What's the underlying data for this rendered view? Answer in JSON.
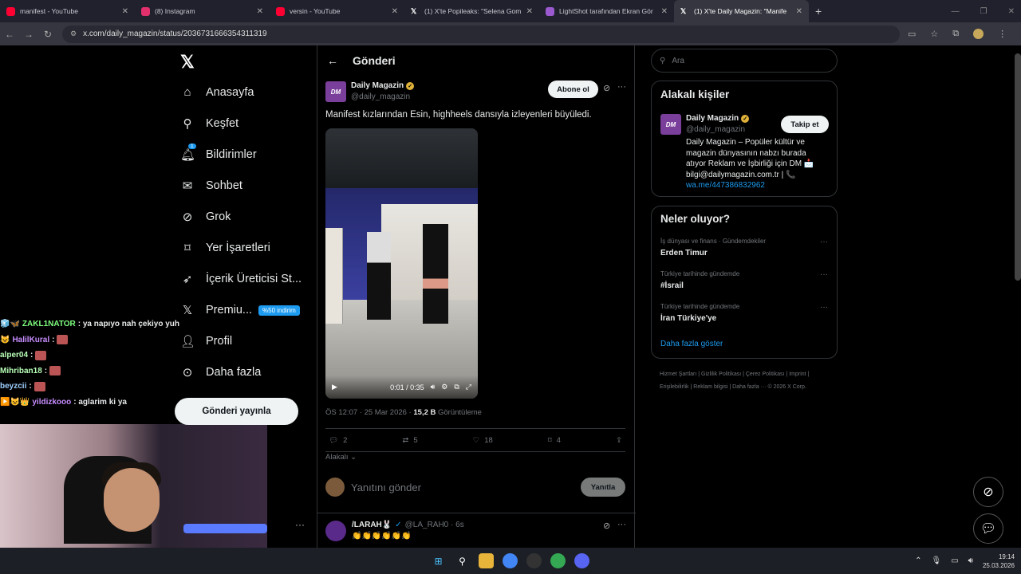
{
  "browser": {
    "tabs": [
      {
        "title": "manifest - YouTube",
        "icon": "youtube-icon",
        "color": "#ff0033"
      },
      {
        "title": "(8) Instagram",
        "icon": "instagram-icon",
        "color": "#e1306c"
      },
      {
        "title": "versin - YouTube",
        "icon": "youtube-icon",
        "color": "#ff0033"
      },
      {
        "title": "(1) X'te Popileaks: \"Selena Gom",
        "icon": "x-icon",
        "color": "#ffffff"
      },
      {
        "title": "LightShot tarafından Ekran Gör",
        "icon": "lightshot-icon",
        "color": "#9b59d0"
      },
      {
        "title": "(1) X'te Daily Magazin: \"Manife",
        "icon": "x-icon",
        "color": "#ffffff"
      }
    ],
    "url": "x.com/daily_magazin/status/2036731666354311319"
  },
  "sidebar": {
    "items": [
      {
        "label": "Anasayfa",
        "icon": "home-icon"
      },
      {
        "label": "Keşfet",
        "icon": "search-icon"
      },
      {
        "label": "Bildirimler",
        "icon": "bell-icon"
      },
      {
        "label": "Sohbet",
        "icon": "mail-icon"
      },
      {
        "label": "Grok",
        "icon": "grok-icon"
      },
      {
        "label": "Yer İşaretleri",
        "icon": "bookmark-icon"
      },
      {
        "label": "İçerik Üreticisi St...",
        "icon": "rocket-icon"
      },
      {
        "label": "Premiu...",
        "icon": "x-icon"
      },
      {
        "label": "Profil",
        "icon": "person-icon"
      },
      {
        "label": "Daha fazla",
        "icon": "more-icon"
      }
    ],
    "notification_count": "1",
    "premium_badge": "%50 indirim",
    "post_button": "Gönderi yayınla"
  },
  "main": {
    "header_title": "Gönderi",
    "author_name": "Daily Magazin",
    "author_handle": "@daily_magazin",
    "avatar_text": "DM",
    "follow_button": "Abone ol",
    "tweet_text": "Manifest kızlarından Esin, highheels dansıyla izleyenleri büyüledi.",
    "video_time": "0:01 / 0:35",
    "meta_time": "ÖS 12:07 · 25 Mar 2026 · ",
    "meta_views": "15,2 B",
    "meta_views_label": " Görüntüleme",
    "actions": {
      "replies": "2",
      "reposts": "5",
      "likes": "18",
      "bookmarks": "4"
    },
    "related": "Alakalı",
    "reply_placeholder": "Yanıtını gönder",
    "reply_button": "Yanıtla",
    "reply": {
      "name": "/LARAH🐰",
      "handle": "@LA_RAH0 · 6s",
      "text": "👏👏👏👏👏👏"
    }
  },
  "right": {
    "search_placeholder": "Ara",
    "related_title": "Alakalı kişiler",
    "person_name": "Daily Magazin",
    "person_handle": "@daily_magazin",
    "person_follow": "Takip et",
    "bio": "Daily Magazin – Popüler kültür ve magazin dünyasının nabzı burada atıyor Reklam ve İşbirliği için DM 📩 bilgi@dailymagazin.com.tr | 📞",
    "bio_link": "wa.me/447386832962",
    "trends_title": "Neler oluyor?",
    "trends": [
      {
        "category": "İş dünyası ve finans · Gündemdekiler",
        "name": "Erden Timur"
      },
      {
        "category": "Türkiye tarihinde gündemde",
        "name": "#İsrail"
      },
      {
        "category": "Türkiye tarihinde gündemde",
        "name": "İran Türkiye'ye"
      }
    ],
    "show_more": "Daha fazla göster",
    "footer": "Hizmet Şartları  |  Gizlilik Politikası  |  Çerez Politikası  |  Imprint  |  Erişilebilirlik  |  Reklam bilgisi  |  Daha fazla ···  © 2026 X Corp."
  },
  "chat": [
    {
      "user": "ZAKL1NATOR",
      "color": "#7fff7f",
      "msg": ": ya napıyo nah çekiyo yuh",
      "badges": "🧊🦋"
    },
    {
      "user": "HalilKural",
      "color": "#c88dff",
      "msg": " :",
      "badges": "😺"
    },
    {
      "user": "alper04",
      "color": "#b8ffb8",
      "msg": " :",
      "badges": ""
    },
    {
      "user": "Mihriban18",
      "color": "#b8ffb8",
      "msg": " :",
      "badges": ""
    },
    {
      "user": "beyzcii",
      "color": "#9fd0ff",
      "msg": " :",
      "badges": ""
    },
    {
      "user": "yildizkooo",
      "color": "#c88dff",
      "msg": " : aglarim ki ya",
      "badges": "▶️😺👑"
    }
  ],
  "taskbar": {
    "time": "19:14",
    "date": "25.03.2026"
  }
}
